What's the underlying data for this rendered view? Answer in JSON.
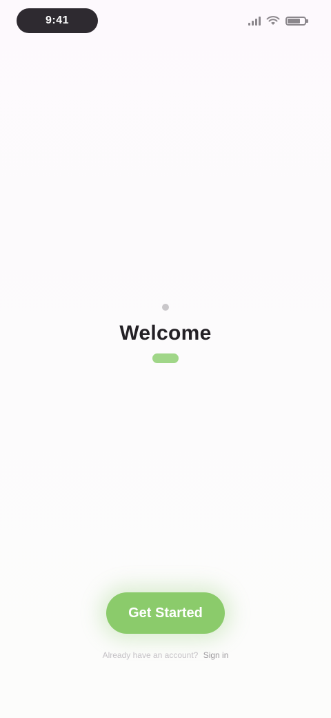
{
  "status_bar": {
    "time": "9:41",
    "battery_level": 0.8,
    "signal_bars": 4
  },
  "main": {
    "title": "Welcome",
    "accent_color": "#8bcb6b"
  },
  "actions": {
    "primary_label": "Get Started"
  },
  "footer": {
    "prefix": "Already have an account?",
    "link_label": "Sign in"
  },
  "colors": {
    "background": "#fdfbfd",
    "text_primary": "#232025",
    "button": "#8bcb6b"
  }
}
